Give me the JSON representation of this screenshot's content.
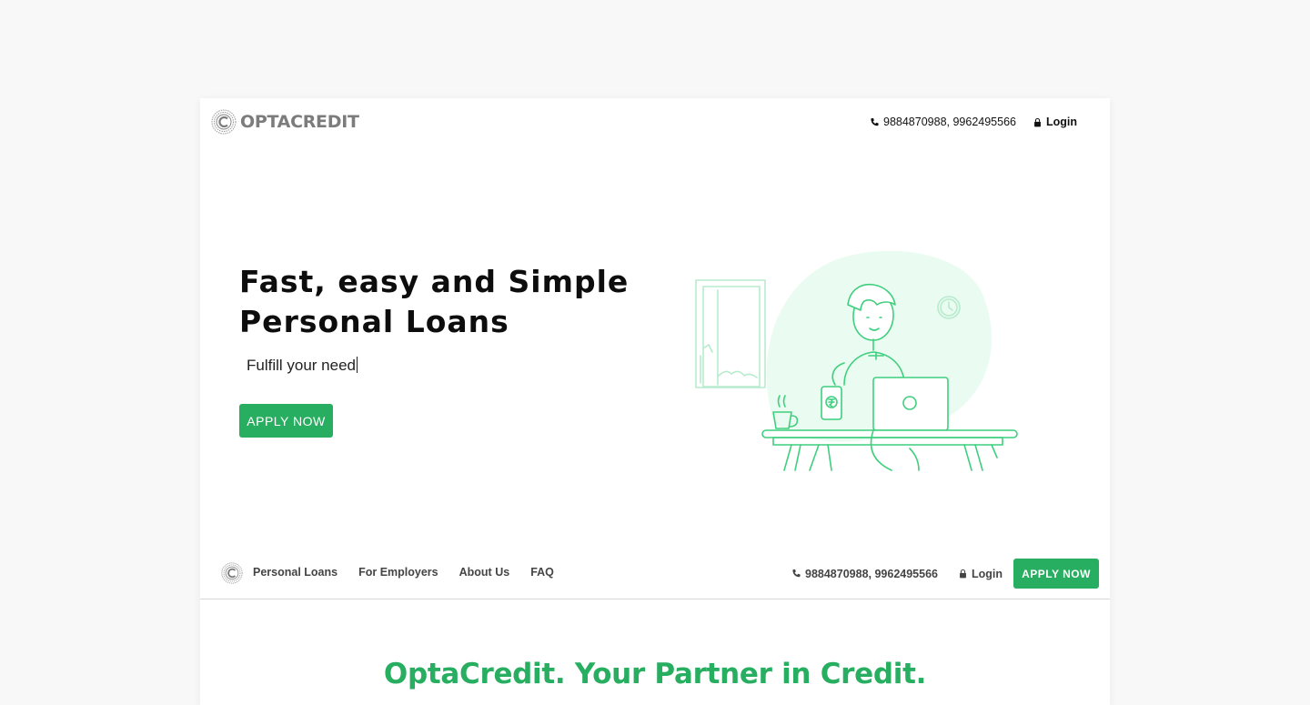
{
  "brand": {
    "name": "OPTACREDIT",
    "accent_color": "#27ae60",
    "logo_color": "#7c7c7c"
  },
  "top_header": {
    "phone": "9884870988, 9962495566",
    "phone_icon": "phone-icon",
    "login_label": "Login",
    "login_icon": "lock-icon"
  },
  "hero": {
    "title_line1": "Fast, easy and Simple",
    "title_line2": "Personal Loans",
    "subtitle": "Fulfill your need",
    "apply_label": "APPLY NOW",
    "illustration": "person-with-laptop-and-phone-illustration"
  },
  "nav": {
    "links": [
      {
        "label": "Personal Loans"
      },
      {
        "label": "For Employers"
      },
      {
        "label": "About Us"
      },
      {
        "label": "FAQ"
      }
    ],
    "phone": "9884870988, 9962495566",
    "login_label": "Login",
    "apply_label": "APPLY NOW"
  },
  "tagline": "OptaCredit. Your Partner in Credit."
}
